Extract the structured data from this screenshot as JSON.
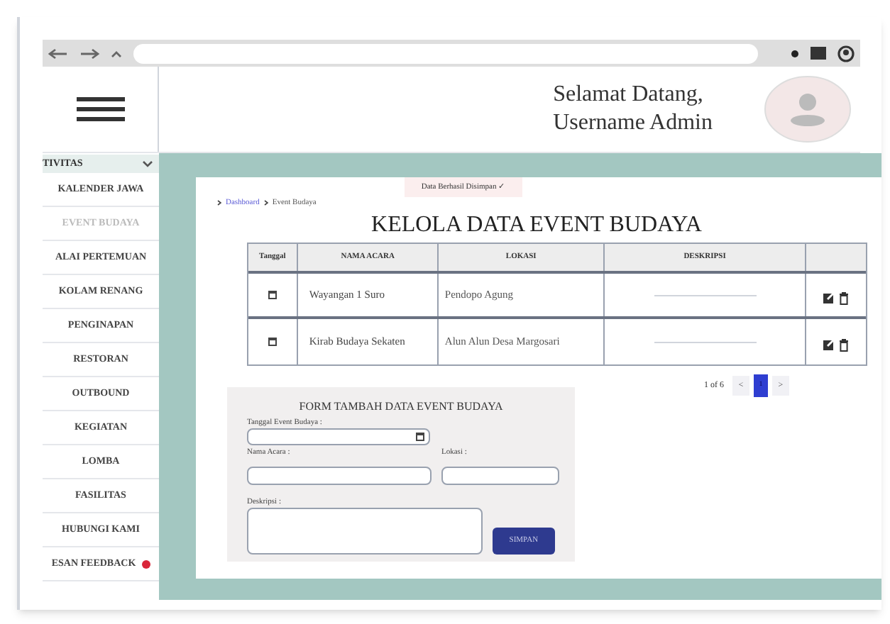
{
  "header": {
    "greeting": "Selamat Datang,",
    "username": "Username Admin"
  },
  "sidebar": {
    "section": {
      "label": "TIVITAS",
      "expanded": true
    },
    "items": [
      {
        "label": "KALENDER JAWA",
        "selected": false,
        "badge": false
      },
      {
        "label": "EVENT BUDAYA",
        "selected": true,
        "badge": false
      },
      {
        "label": "ALAI PERTEMUAN",
        "selected": false,
        "badge": false
      },
      {
        "label": "KOLAM RENANG",
        "selected": false,
        "badge": false
      },
      {
        "label": "PENGINAPAN",
        "selected": false,
        "badge": false
      },
      {
        "label": "RESTORAN",
        "selected": false,
        "badge": false
      },
      {
        "label": "OUTBOUND",
        "selected": false,
        "badge": false
      },
      {
        "label": "KEGIATAN",
        "selected": false,
        "badge": false
      },
      {
        "label": "LOMBA",
        "selected": false,
        "badge": false
      },
      {
        "label": "FASILITAS",
        "selected": false,
        "badge": false
      },
      {
        "label": "HUBUNGI KAMI",
        "selected": false,
        "badge": false
      },
      {
        "label": "ESAN FEEDBACK",
        "selected": false,
        "badge": true
      }
    ]
  },
  "toast": "Data Berhasil Disimpan ✓",
  "breadcrumb": [
    {
      "label": "Dashboard",
      "link": true
    },
    {
      "label": "Event Budaya",
      "link": false
    }
  ],
  "title": "KELOLA DATA EVENT BUDAYA",
  "table": {
    "columns": [
      "Tanggal",
      "NAMA ACARA",
      "LOKASI",
      "DESKRIPSI"
    ],
    "rows": [
      {
        "nama_acara": "Wayangan 1 Suro",
        "lokasi": "Pendopo Agung"
      },
      {
        "nama_acara": "Kirab Budaya Sekaten",
        "lokasi": "Alun Alun Desa Margosari"
      }
    ]
  },
  "pagination": {
    "info": "1 of 6",
    "prev": "<",
    "pages": [
      {
        "label": "1",
        "selected": true
      }
    ],
    "next": ">"
  },
  "form": {
    "title": "FORM TAMBAH DATA EVENT BUDAYA",
    "date_label": "Tanggal Event Budaya :",
    "name_label": "Nama Acara :",
    "location_label": "Lokasi :",
    "description_label": "Deskripsi :",
    "submit": "SIMPAN"
  }
}
